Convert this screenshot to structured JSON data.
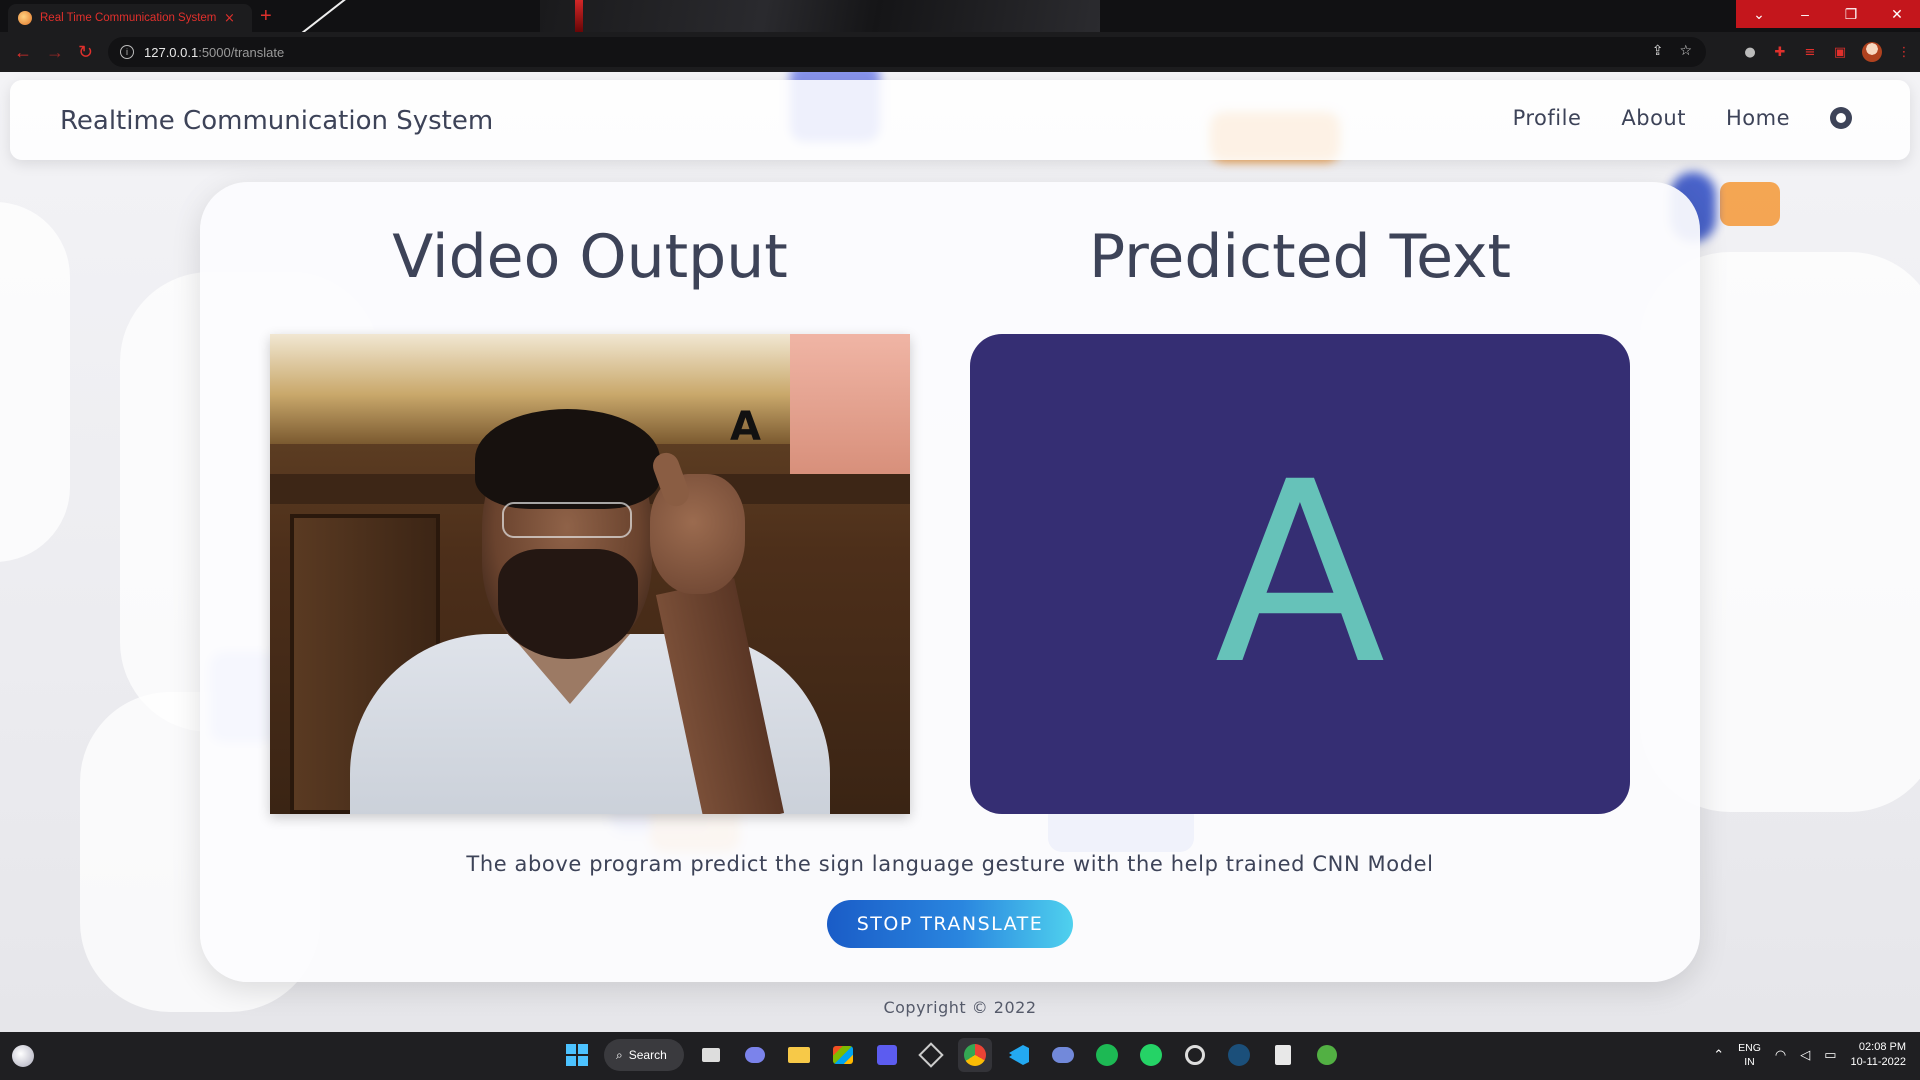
{
  "browser": {
    "tab_title": "Real Time Communication System",
    "tab_close": "×",
    "new_tab": "+",
    "url_host": "127.0.0.1",
    "url_rest": ":5000/translate",
    "window_controls": [
      "⌄",
      "–",
      "❐",
      "✕"
    ],
    "nav": {
      "back": "←",
      "forward": "→",
      "reload": "↻"
    }
  },
  "navbar": {
    "brand": "Realtime Communication System",
    "links": [
      "Profile",
      "About",
      "Home"
    ],
    "github_icon": "github-icon"
  },
  "main": {
    "video_heading": "Video Output",
    "prediction_heading": "Predicted Text",
    "video_overlay_letter": "A",
    "predicted_letter": "A",
    "description": "The above program predict the sign language gesture with the help trained CNN Model",
    "stop_button": "STOP TRANSLATE"
  },
  "footer": {
    "copyright": "Copyright © 2022"
  },
  "taskbar": {
    "search_label": "Search",
    "language_line1": "ENG",
    "language_line2": "IN",
    "time": "02:08 PM",
    "date": "10-11-2022"
  },
  "colors": {
    "prediction_bg": "#352e73",
    "prediction_letter": "#66c2b9",
    "heading_text": "#3d4358",
    "button_start": "#1a5cc7",
    "button_end": "#4fd1ee",
    "browser_accent": "#e0302c"
  }
}
